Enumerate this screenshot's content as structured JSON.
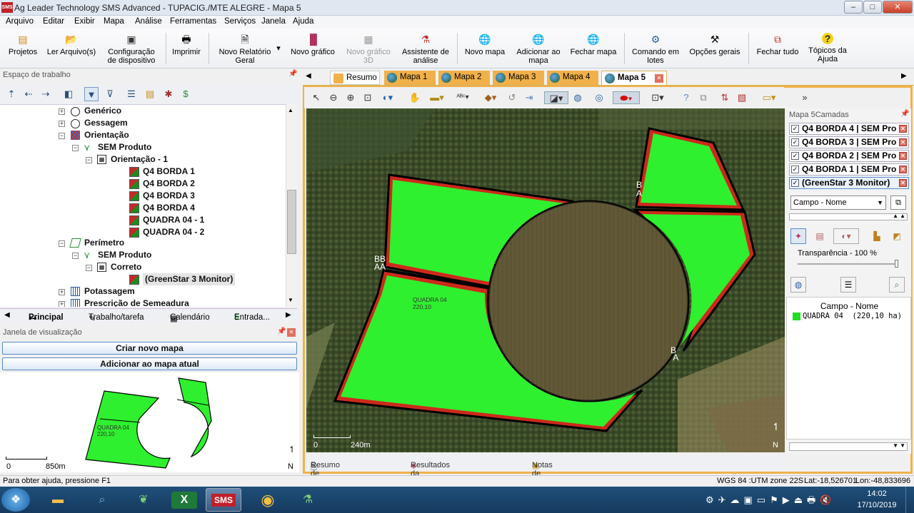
{
  "window": {
    "title": "Ag Leader Technology SMS Advanced - TUPACIG./MTE ALEGRE - Mapa 5",
    "minimize": "–",
    "maximize": "□",
    "close": "✕"
  },
  "menu": [
    "Arquivo",
    "Editar",
    "Exibir",
    "Mapa",
    "Análise",
    "Ferramentas",
    "Serviços",
    "Janela",
    "Ajuda"
  ],
  "toolbar": {
    "projetos": "Projetos",
    "ler_arquivos": "Ler Arquivo(s)",
    "config_1": "Configuração",
    "config_2": "de dispositivo",
    "imprimir": "Imprimir",
    "relatorio_1": "Novo Relatório",
    "relatorio_2": "Geral",
    "grafico": "Novo gráfico",
    "grafico3d_1": "Novo gráfico",
    "grafico3d_2": "3D",
    "assist_1": "Assistente de",
    "assist_2": "análise",
    "novo_mapa": "Novo mapa",
    "adic_1": "Adicionar ao",
    "adic_2": "mapa",
    "fechar_mapa": "Fechar mapa",
    "comando_1": "Comando em",
    "comando_2": "lotes",
    "opcoes": "Opções gerais",
    "fechar_tudo": "Fechar tudo",
    "topicos_1": "Tópicos da",
    "topicos_2": "Ajuda"
  },
  "workspace": {
    "header": "Espaço de trabalho",
    "tree": {
      "generico": "Genérico",
      "gessagem": "Gessagem",
      "orientacao": "Orientação",
      "sem_produto": "SEM Produto",
      "orientacao_1": "Orientação - 1",
      "q4b1": "Q4 BORDA 1",
      "q4b2": "Q4 BORDA 2",
      "q4b3": "Q4 BORDA 3",
      "q4b4": "Q4 BORDA 4",
      "quadra1": "QUADRA 04 - 1",
      "quadra2": "QUADRA 04 - 2",
      "perimetro": "Perímetro",
      "sem_produto2": "SEM Produto",
      "correto": "Correto",
      "greenstar": "(GreenStar 3 Monitor)",
      "potassagem": "Potassagem",
      "prescricao": "Prescrição de Semeadura"
    },
    "tabs": {
      "principal": "Principal",
      "trabalho": "Trabalho/tarefa",
      "calendario": "Calendário",
      "entrada": "Entrada..."
    }
  },
  "viewer": {
    "header": "Janela de visualização",
    "criar": "Criar novo mapa",
    "adicionar": "Adicionar ao mapa atual",
    "label_1": "QUADRA 04",
    "label_2": "220,10",
    "scale_zero": "0",
    "scale_dist": "850m",
    "north": "N"
  },
  "map_tabs": [
    "Resumo",
    "Mapa 1",
    "Mapa 2",
    "Mapa 3",
    "Mapa 4",
    "Mapa 5"
  ],
  "map": {
    "label_1": "QUADRA 04",
    "label_2": "220,10",
    "scale_zero": "0",
    "scale_dist": "240m",
    "north": "N",
    "marker_a": "A",
    "marker_b": "B"
  },
  "bottom_tabs": {
    "resumo": "Resumo de mapa",
    "resultados": "Resultados da consulta",
    "notas": "Notas de Imagem"
  },
  "layers_panel": {
    "header": "Mapa 5Camadas",
    "layers": [
      "Q4 BORDA 4 | SEM Pro",
      "Q4 BORDA 3 | SEM Pro",
      "Q4 BORDA 2 | SEM Pro",
      "Q4 BORDA 1 | SEM Pro",
      "(GreenStar 3 Monitor)"
    ],
    "dropdown": "Campo - Nome",
    "transparency": "Transparência - 100 %",
    "legend_title": "Campo - Nome",
    "legend_item": "QUADRA 04  (220,10 ha)",
    "legend_color": "#22dd22"
  },
  "status": {
    "help": "Para obter ajuda, pressione F1",
    "coord_sys": "WGS 84 :UTM zone 22S",
    "lat": "Lat:-18,526701",
    "lon": "Lon:-48,833696"
  },
  "taskbar": {
    "time": "14:02",
    "date": "17/10/2019"
  },
  "colors": {
    "field": "#2ef02e",
    "border_red": "#cc2a1a",
    "accent": "#f0b14a"
  }
}
